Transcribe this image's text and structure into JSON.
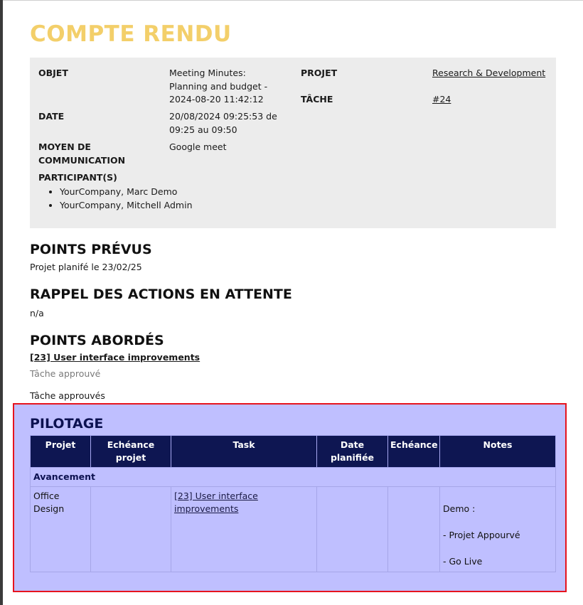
{
  "title": "COMPTE RENDU",
  "info": {
    "objet_label": "OBJET",
    "objet_value": "Meeting Minutes: Planning and budget - 2024-08-20 11:42:12",
    "date_label": "DATE",
    "date_value": "20/08/2024 09:25:53 de 09:25 au 09:50",
    "moyen_label": "MOYEN DE COMMUNICATION",
    "moyen_value": "Google meet",
    "participants_label": "PARTICIPANT(S)",
    "participants": [
      "YourCompany, Marc Demo",
      "YourCompany, Mitchell Admin"
    ],
    "projet_label": "PROJET",
    "projet_value": "Research & Development",
    "tache_label": "TÂCHE",
    "tache_value": "#24"
  },
  "points_prevus": {
    "heading": "POINTS PRÉVUS",
    "text": "Projet planifé le 23/02/25"
  },
  "rappel": {
    "heading": "RAPPEL DES ACTIONS EN ATTENTE",
    "text": "n/a"
  },
  "points_abordes": {
    "heading": "POINTS ABORDÉS",
    "link": "[23] User interface improvements",
    "note1": "Tâche approuvé",
    "note2": "Tâche approuvés"
  },
  "pilotage": {
    "heading": "PILOTAGE",
    "columns": [
      "Projet",
      "Echéance projet",
      "Task",
      "Date planifiée",
      "Echéance",
      "Notes"
    ],
    "group": "Avancement",
    "row": {
      "projet": "Office Design",
      "echeance_projet": "",
      "task": "[23] User interface improvements",
      "date_planifiee": "",
      "echeance": "",
      "notes": [
        "Demo :",
        "- Projet Appourvé",
        "- Go Live"
      ]
    }
  },
  "colors": {
    "title": "#f3cf6a",
    "info_bg": "#ececec",
    "pilot_bg": "#bfbfff",
    "pilot_header": "#0e1652",
    "highlight_border": "#e6141e"
  }
}
